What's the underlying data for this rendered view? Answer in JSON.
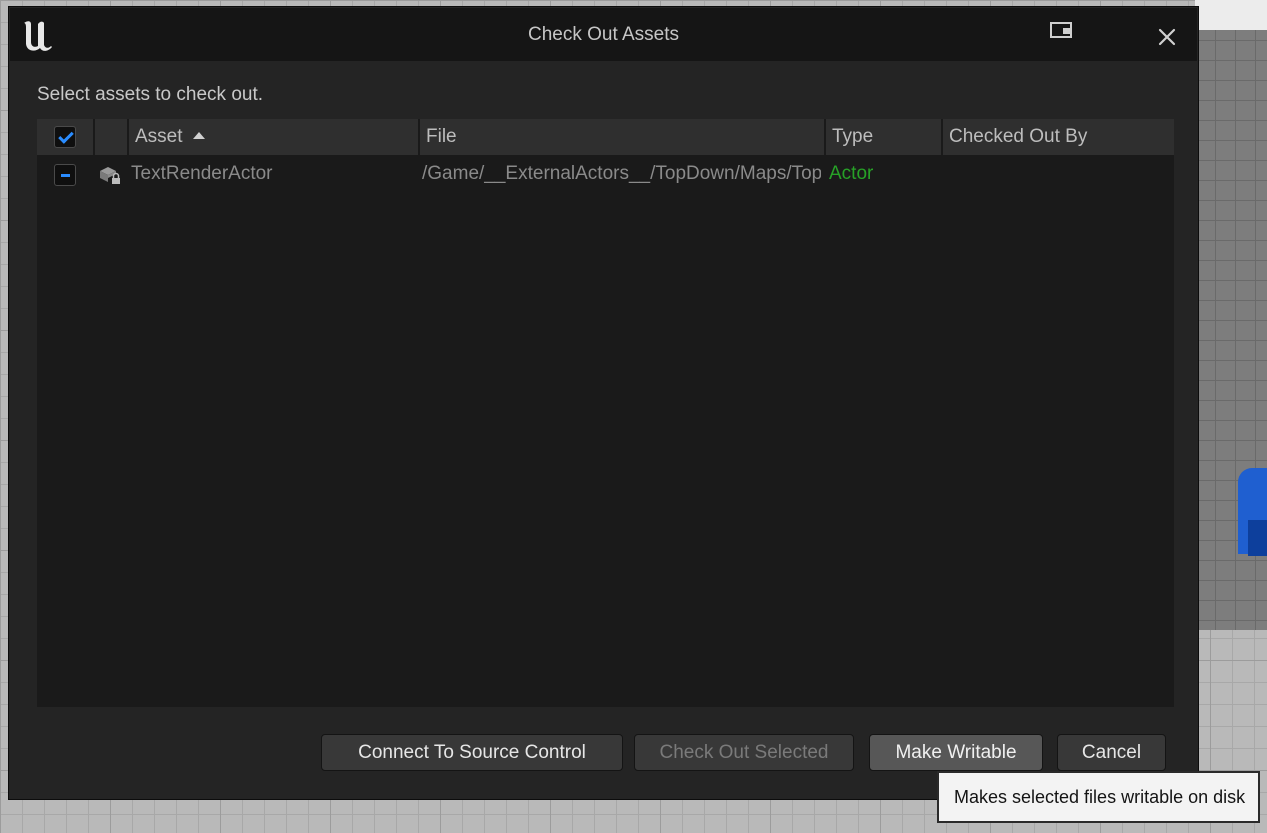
{
  "window": {
    "title": "Check Out Assets",
    "logo_icon": "unreal-engine-logo-icon",
    "restore_icon": "window-restore-icon",
    "close_icon": "close-icon"
  },
  "prompt": "Select assets to check out.",
  "table": {
    "select_all_checked": true,
    "columns": [
      {
        "label": ""
      },
      {
        "label": ""
      },
      {
        "label": "Asset",
        "sort": "ascending"
      },
      {
        "label": "File"
      },
      {
        "label": "Type"
      },
      {
        "label": "Checked Out By"
      }
    ],
    "rows": [
      {
        "checkbox_state": "indeterminate",
        "icon": "actor-package-lock-icon",
        "asset": "TextRenderActor",
        "file": "/Game/__ExternalActors__/TopDown/Maps/TopDownMap/",
        "type": "Actor",
        "checked_out_by": ""
      }
    ]
  },
  "buttons": {
    "connect": "Connect To Source Control",
    "check_out_selected": "Check Out Selected",
    "make_writable": "Make Writable",
    "cancel": "Cancel"
  },
  "tooltip": "Makes selected files writable on disk",
  "colors": {
    "accent_blue": "#2a8cff",
    "type_green": "#27a127",
    "dialog_bg": "#242424",
    "titlebar_bg": "#151515"
  }
}
